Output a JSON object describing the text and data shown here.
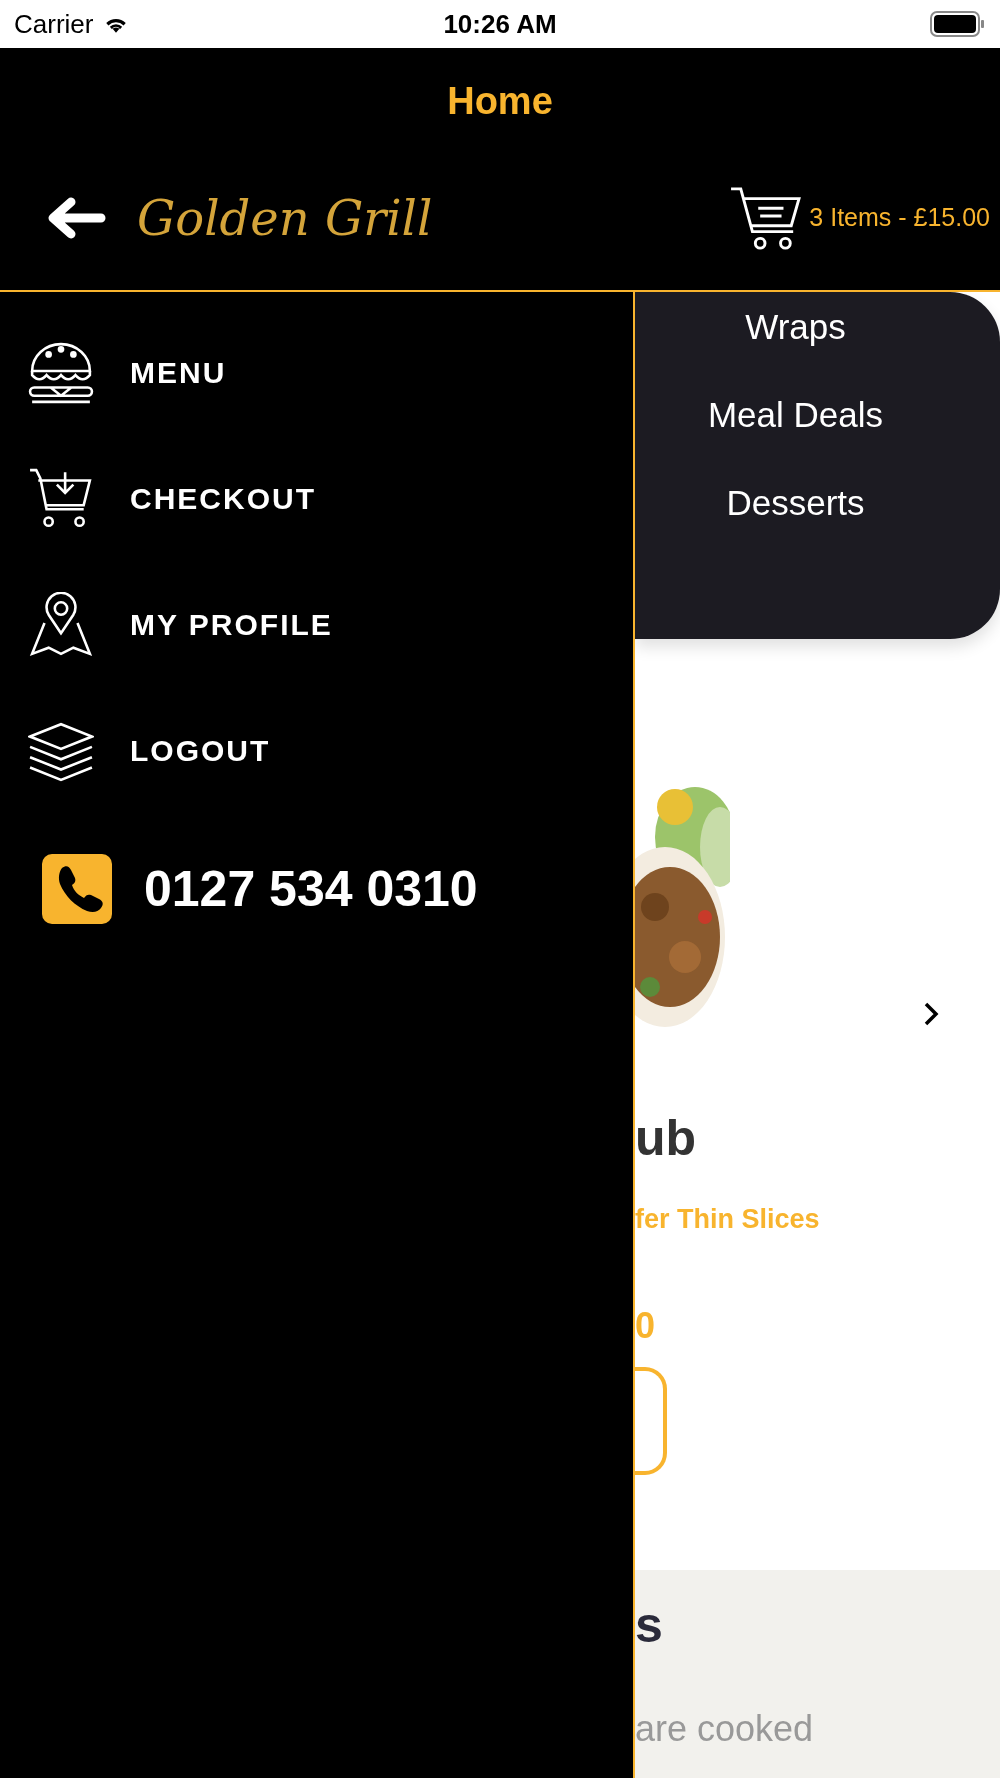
{
  "status_bar": {
    "carrier": "Carrier",
    "time": "10:26 AM"
  },
  "header": {
    "title": "Home",
    "logo": "Golden Grill",
    "cart_summary": "3 Items - £15.00"
  },
  "drawer": {
    "items": [
      {
        "label": "MENU",
        "kind": "burger"
      },
      {
        "label": "CHECKOUT",
        "kind": "cart"
      },
      {
        "label": "MY PROFILE",
        "kind": "map"
      },
      {
        "label": "LOGOUT",
        "kind": "layers"
      }
    ],
    "phone": "0127 534 0310"
  },
  "categories": [
    "Wraps",
    "Meal Deals",
    "Desserts"
  ],
  "product": {
    "name": "ub",
    "description": "fer Thin Slices",
    "price": "0"
  },
  "info": {
    "heading": "s",
    "text": "are cooked"
  }
}
